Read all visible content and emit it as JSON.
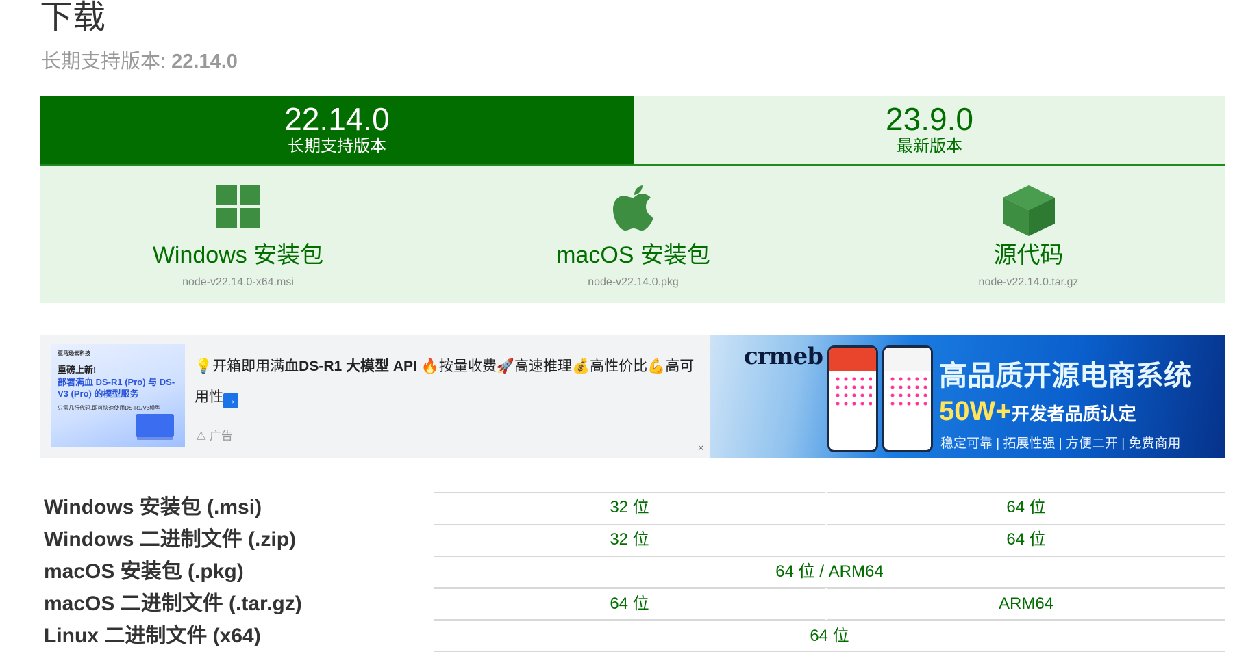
{
  "header": {
    "title": "下载",
    "subtitle_prefix": "长期支持版本: ",
    "subtitle_version": "22.14.0"
  },
  "tabs": [
    {
      "version": "22.14.0",
      "label": "长期支持版本",
      "active": true
    },
    {
      "version": "23.9.0",
      "label": "最新版本",
      "active": false
    }
  ],
  "downloads": [
    {
      "icon": "windows-icon",
      "name": "Windows 安装包",
      "file": "node-v22.14.0-x64.msi"
    },
    {
      "icon": "apple-icon",
      "name": "macOS 安装包",
      "file": "node-v22.14.0.pkg"
    },
    {
      "icon": "box-icon",
      "name": "源代码",
      "file": "node-v22.14.0.tar.gz"
    }
  ],
  "ad_left": {
    "thumb_brand": "亚马逊云科技",
    "thumb_line1": "重磅上新!",
    "thumb_line2": "部署满血 DS-R1 (Pro) 与 DS-V3 (Pro) 的模型服务",
    "thumb_line3": "只需几行代码,即可快速使用DS-R1/V3模型",
    "text_a": "💡开箱即用满血",
    "text_bold": "DS-R1 大模型 API",
    "text_b": " 🔥按量收费🚀高速推理💰高性价比💪高可用性",
    "arrow": "→",
    "label": "广告",
    "close": "×"
  },
  "ad_right": {
    "logo": "crmeb",
    "headline": "高品质开源电商系统",
    "sub_big": "50W+",
    "sub_rest": "开发者品质认定",
    "tagline": "稳定可靠 | 拓展性强 | 方便二开 | 免费商用"
  },
  "table": [
    {
      "name": "Windows 安装包 (.msi)",
      "cells": [
        "32 位",
        "64 位"
      ]
    },
    {
      "name": "Windows 二进制文件 (.zip)",
      "cells": [
        "32 位",
        "64 位"
      ]
    },
    {
      "name": "macOS 安装包 (.pkg)",
      "cells": [
        "64 位 / ARM64"
      ]
    },
    {
      "name": "macOS 二进制文件 (.tar.gz)",
      "cells": [
        "64 位",
        "ARM64"
      ]
    },
    {
      "name": "Linux 二进制文件 (x64)",
      "cells": [
        "64 位"
      ]
    }
  ],
  "colors": {
    "brand_green": "#026e00",
    "light_green": "#e6f5e6"
  }
}
